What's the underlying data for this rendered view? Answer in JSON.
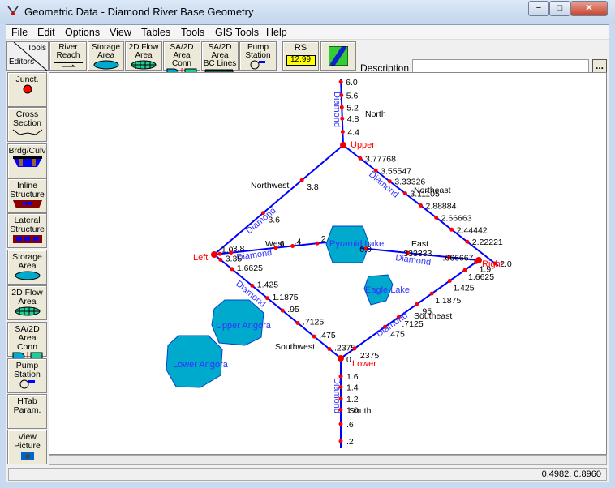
{
  "window": {
    "title": "Geometric Data - Diamond River Base Geometry",
    "controls": [
      "−",
      "□",
      "✕"
    ]
  },
  "menu": [
    "File",
    "Edit",
    "Options",
    "View",
    "Tables",
    "Tools",
    "GIS Tools",
    "Help"
  ],
  "toolbar": {
    "corner": {
      "tools": "Tools",
      "editors": "Editors"
    },
    "tools": [
      {
        "l1": "River",
        "l2": "Reach"
      },
      {
        "l1": "Storage",
        "l2": "Area"
      },
      {
        "l1": "2D Flow",
        "l2": "Area"
      },
      {
        "l1": "SA/2D Area",
        "l2": "Conn"
      },
      {
        "l1": "SA/2D Area",
        "l2": "BC Lines"
      },
      {
        "l1": "Pump",
        "l2": "Station"
      }
    ],
    "rs_label": "RS",
    "rs_value": "12.99",
    "description_label": "Description :",
    "description_value": "",
    "description_button": "..."
  },
  "editors": [
    {
      "l1": "Junct.",
      "l2": ""
    },
    {
      "l1": "Cross",
      "l2": "Section"
    },
    {
      "l1": "Brdg/Culv",
      "l2": ""
    },
    {
      "l1": "Inline",
      "l2": "Structure"
    },
    {
      "l1": "Lateral",
      "l2": "Structure"
    },
    {
      "l1": "Storage",
      "l2": "Area"
    },
    {
      "l1": "2D Flow",
      "l2": "Area"
    },
    {
      "l1": "SA/2D Area",
      "l2": "Conn"
    },
    {
      "l1": "Pump",
      "l2": "Station"
    },
    {
      "l1": "HTab",
      "l2": "Param."
    },
    {
      "l1": "View",
      "l2": "Picture"
    }
  ],
  "colors": {
    "river": "#0000ff",
    "xs": "#ff0000",
    "junction_label": "#ff0000",
    "storage": "#00aacc",
    "river_label": "#3333ff"
  },
  "map": {
    "junctions": [
      "Upper",
      "Left",
      "Right",
      "Lower"
    ],
    "storage_areas": [
      "Pyramid Lake",
      "Eagle Lake",
      "Upper Angora",
      "Lower Angora"
    ],
    "river": "Diamond",
    "reaches": [
      {
        "name": "North",
        "stations": [
          "6.0",
          "5.6",
          "5.2",
          "4.8",
          "4.4"
        ]
      },
      {
        "name": "Northwest",
        "stations": [
          "3.8",
          "3.6"
        ]
      },
      {
        "name": "Northeast",
        "stations": [
          "3.77768",
          "3.55547",
          "3.33326",
          "3.11105",
          "2.88884",
          "2.66663",
          "2.44442",
          "2.22221",
          "2.0"
        ]
      },
      {
        "name": "West",
        "stations": [
          "1.0",
          "3.8",
          ".6",
          ".4",
          ".2"
        ]
      },
      {
        "name": "East",
        "stations": [
          "0.0",
          ".333333",
          ".666667"
        ]
      },
      {
        "name": "Southwest",
        "stations": [
          "3.35",
          "1.6625",
          "1.425",
          "1.1875",
          ".95",
          ".7125",
          ".475",
          ".2375"
        ]
      },
      {
        "name": "Southeast",
        "stations": [
          ".2375",
          ".475",
          ".7125",
          ".95",
          "1.1875",
          "1.425",
          "1.6625",
          "1.9"
        ]
      },
      {
        "name": "South",
        "stations": [
          "0",
          "1.6",
          "1.4",
          "1.2",
          "1.0",
          ".6",
          ".2"
        ]
      }
    ]
  },
  "status": {
    "coords": "0.4982, 0.8960"
  }
}
